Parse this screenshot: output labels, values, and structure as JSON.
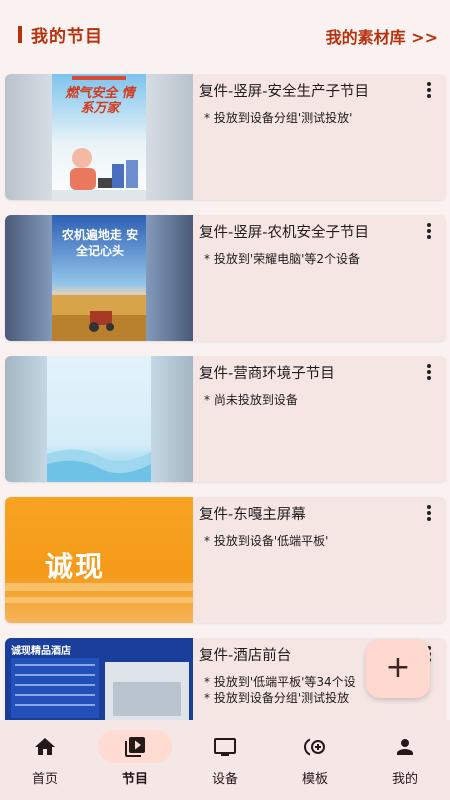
{
  "header": {
    "title": "我的节目",
    "library_link": "我的素材库 >>"
  },
  "programs": [
    {
      "title": "复件-竖屏-安全生产子节目",
      "status": "* 投放到设备分组'测试投放'",
      "status2": "",
      "poster_text": "燃气安全 情系万家",
      "poster_caption": ""
    },
    {
      "title": "复件-竖屏-农机安全子节目",
      "status": "* 投放到'荣耀电脑'等2个设备",
      "status2": "",
      "poster_text": "农机遍地走 安全记心头",
      "poster_caption": ""
    },
    {
      "title": "复件-营商环境子节目",
      "status": "* 尚未投放到设备",
      "status2": "",
      "poster_text": "",
      "poster_caption": ""
    },
    {
      "title": "复件-东嘎主屏幕",
      "status": "* 投放到设备'低端平板'",
      "status2": "",
      "poster_text": "诚现",
      "poster_caption": ""
    },
    {
      "title": "复件-酒店前台",
      "status": "* 投放到'低端平板'等34个设",
      "status2": "* 投放到设备分组'测试投放",
      "poster_text": "诚现精品酒店",
      "poster_caption": ""
    }
  ],
  "fab": {
    "icon": "plus-icon",
    "label": "+"
  },
  "nav": [
    {
      "label": "首页",
      "icon": "home-icon",
      "active": false
    },
    {
      "label": "节目",
      "icon": "video-library-icon",
      "active": true
    },
    {
      "label": "设备",
      "icon": "monitor-icon",
      "active": false
    },
    {
      "label": "模板",
      "icon": "add-circle-stack-icon",
      "active": false
    },
    {
      "label": "我的",
      "icon": "person-icon",
      "active": false
    }
  ],
  "colors": {
    "accent": "#b7310c",
    "card_bg": "#f5e6e4",
    "page_bg": "#faf2f1",
    "fab_bg": "#ffd9cf"
  }
}
